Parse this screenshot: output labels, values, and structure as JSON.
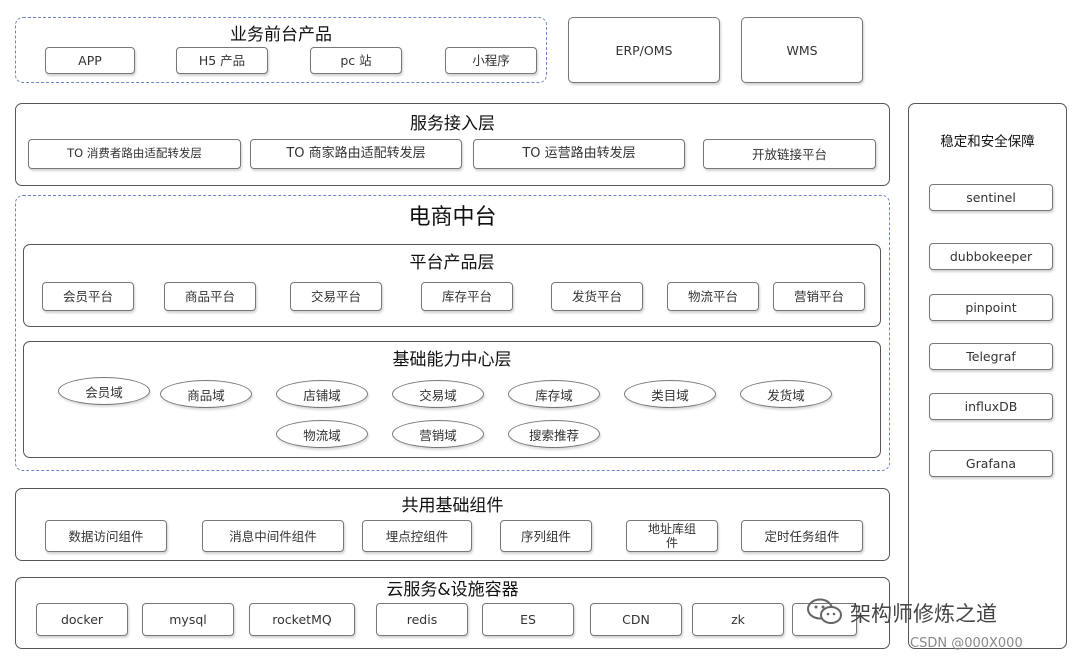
{
  "frontend": {
    "title": "业务前台产品",
    "items": [
      "APP",
      "H5 产品",
      "pc 站",
      "小程序"
    ]
  },
  "erp": "ERP/OMS",
  "wms": "WMS",
  "access": {
    "title": "服务接入层",
    "items": [
      "TO 消费者路由适配转发层",
      "TO 商家路由适配转发层",
      "TO  运营路由转发层",
      "开放链接平台"
    ]
  },
  "mid": {
    "title": "电商中台"
  },
  "platform": {
    "title": "平台产品层",
    "items": [
      "会员平台",
      "商品平台",
      "交易平台",
      "库存平台",
      "发货平台",
      "物流平台",
      "营销平台"
    ]
  },
  "capability": {
    "title": "基础能力中心层",
    "items": [
      "会员域",
      "商品域",
      "店铺域",
      "交易域",
      "库存域",
      "类目域",
      "发货域",
      "物流域",
      "营销域",
      "搜索推荐"
    ]
  },
  "shared": {
    "title": "共用基础组件",
    "items": [
      "数据访问组件",
      "消息中间件组件",
      "埋点控组件",
      "序列组件",
      "地址库组\n件",
      "定时任务组件"
    ]
  },
  "cloud": {
    "title": "云服务&设施容器",
    "items": [
      "docker",
      "mysql",
      "rocketMQ",
      "redis",
      "ES",
      "CDN",
      "zk",
      ""
    ]
  },
  "stability": {
    "title": "稳定和安全保障",
    "items": [
      "sentinel",
      "dubbokeeper",
      "pinpoint",
      "Telegraf",
      "influxDB",
      "Grafana"
    ]
  },
  "watermark": {
    "main": "架构师修炼之道",
    "sub": "CSDN @000X000"
  }
}
